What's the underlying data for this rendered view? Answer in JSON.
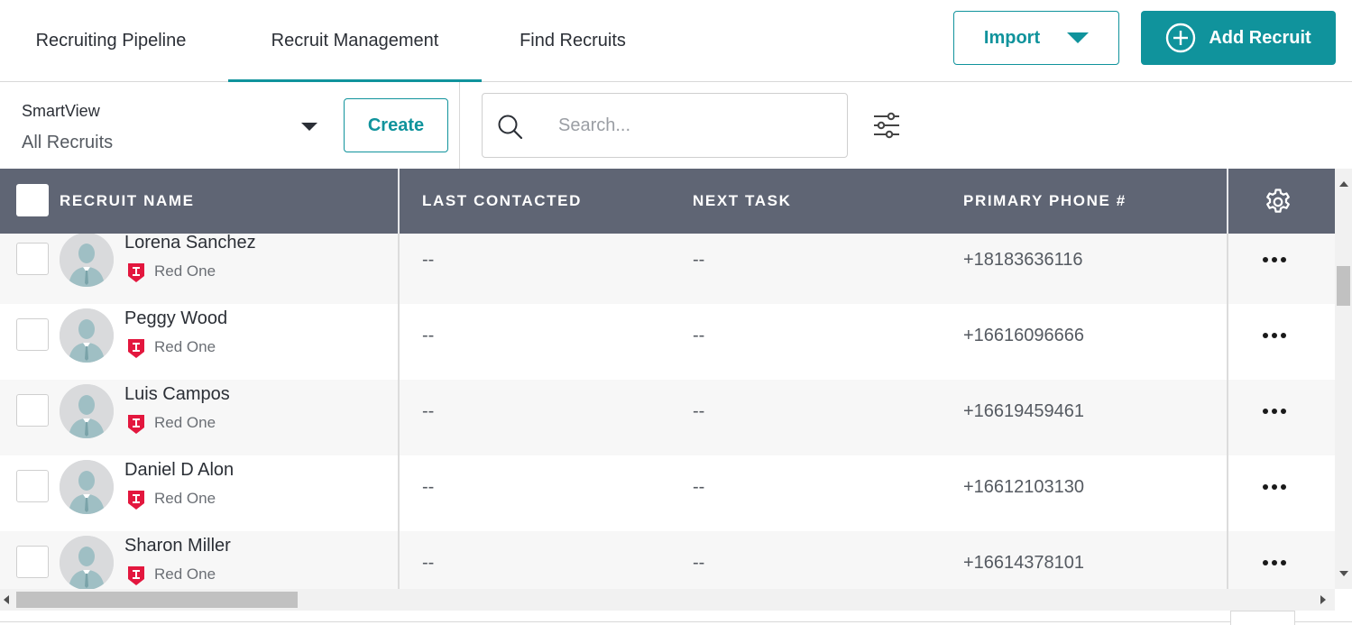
{
  "tabs": [
    {
      "label": "Recruiting Pipeline",
      "active": false
    },
    {
      "label": "Recruit Management",
      "active": true
    },
    {
      "label": "Find Recruits",
      "active": false
    }
  ],
  "header": {
    "import_label": "Import",
    "add_label": "Add Recruit"
  },
  "toolbar": {
    "smartview_label": "SmartView",
    "smartview_value": "All Recruits",
    "create_label": "Create",
    "search_placeholder": "Search...",
    "search_value": ""
  },
  "table": {
    "columns": [
      "RECRUIT NAME",
      "LAST CONTACTED",
      "NEXT TASK",
      "PRIMARY PHONE #"
    ],
    "rows": [
      {
        "name": "Lorena Sanchez",
        "org": "Red One",
        "last_contacted": "--",
        "next_task": "--",
        "phone": "+18183636116"
      },
      {
        "name": "Peggy Wood",
        "org": "Red One",
        "last_contacted": "--",
        "next_task": "--",
        "phone": "+16616096666"
      },
      {
        "name": "Luis Campos",
        "org": "Red One",
        "last_contacted": "--",
        "next_task": "--",
        "phone": "+16619459461"
      },
      {
        "name": "Daniel D Alon",
        "org": "Red One",
        "last_contacted": "--",
        "next_task": "--",
        "phone": "+16612103130"
      },
      {
        "name": "Sharon Miller",
        "org": "Red One",
        "last_contacted": "--",
        "next_task": "--",
        "phone": "+16614378101"
      }
    ]
  },
  "icons": {
    "add": "plus-circle-icon",
    "import_caret": "caret-down-icon",
    "search": "search-icon",
    "filter": "sliders-icon",
    "settings": "gear-icon",
    "row_menu": "more-horizontal-icon",
    "avatar": "user-avatar-icon",
    "org_badge": "shield-badge-icon"
  },
  "colors": {
    "accent": "#10939c",
    "header_bg": "#5f6574",
    "badge": "#e3173e"
  }
}
